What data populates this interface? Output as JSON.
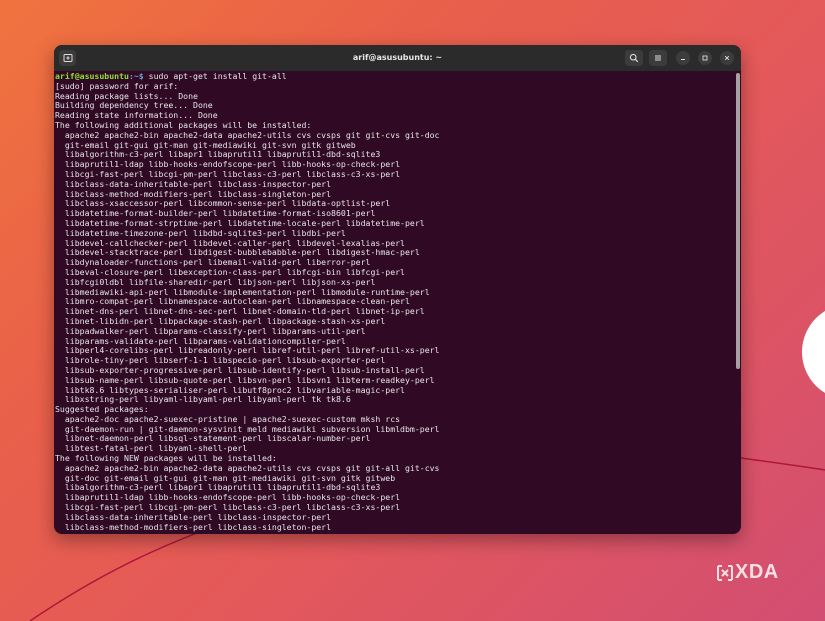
{
  "window": {
    "title": "arif@asusubuntu: ~"
  },
  "prompt": {
    "user_host": "arif@asusubuntu",
    "path_sep": ":~$",
    "command": " sudo apt-get install git-all"
  },
  "output_lines": [
    "[sudo] password for arif:",
    "Reading package lists... Done",
    "Building dependency tree... Done",
    "Reading state information... Done",
    "The following additional packages will be installed:",
    "  apache2 apache2-bin apache2-data apache2-utils cvs cvsps git git-cvs git-doc",
    "  git-email git-gui git-man git-mediawiki git-svn gitk gitweb",
    "  libalgorithm-c3-perl libapr1 libaprutil1 libaprutil1-dbd-sqlite3",
    "  libaprutil1-ldap libb-hooks-endofscope-perl libb-hooks-op-check-perl",
    "  libcgi-fast-perl libcgi-pm-perl libclass-c3-perl libclass-c3-xs-perl",
    "  libclass-data-inheritable-perl libclass-inspector-perl",
    "  libclass-method-modifiers-perl libclass-singleton-perl",
    "  libclass-xsaccessor-perl libcommon-sense-perl libdata-optlist-perl",
    "  libdatetime-format-builder-perl libdatetime-format-iso8601-perl",
    "  libdatetime-format-strptime-perl libdatetime-locale-perl libdatetime-perl",
    "  libdatetime-timezone-perl libdbd-sqlite3-perl libdbi-perl",
    "  libdevel-callchecker-perl libdevel-caller-perl libdevel-lexalias-perl",
    "  libdevel-stacktrace-perl libdigest-bubblebabble-perl libdigest-hmac-perl",
    "  libdynaloader-functions-perl libemail-valid-perl liberror-perl",
    "  libeval-closure-perl libexception-class-perl libfcgi-bin libfcgi-perl",
    "  libfcgi0ldbl libfile-sharedir-perl libjson-perl libjson-xs-perl",
    "  libmediawiki-api-perl libmodule-implementation-perl libmodule-runtime-perl",
    "  libmro-compat-perl libnamespace-autoclean-perl libnamespace-clean-perl",
    "  libnet-dns-perl libnet-dns-sec-perl libnet-domain-tld-perl libnet-ip-perl",
    "  libnet-libidn-perl libpackage-stash-perl libpackage-stash-xs-perl",
    "  libpadwalker-perl libparams-classify-perl libparams-util-perl",
    "  libparams-validate-perl libparams-validationcompiler-perl",
    "  libperl4-corelibs-perl libreadonly-perl libref-util-perl libref-util-xs-perl",
    "  librole-tiny-perl libserf-1-1 libspecio-perl libsub-exporter-perl",
    "  libsub-exporter-progressive-perl libsub-identify-perl libsub-install-perl",
    "  libsub-name-perl libsub-quote-perl libsvn-perl libsvn1 libterm-readkey-perl",
    "  libtk8.6 libtypes-serialiser-perl libutf8proc2 libvariable-magic-perl",
    "  libxstring-perl libyaml-libyaml-perl libyaml-perl tk tk8.6",
    "Suggested packages:",
    "  apache2-doc apache2-suexec-pristine | apache2-suexec-custom mksh rcs",
    "  git-daemon-run | git-daemon-sysvinit meld mediawiki subversion libmldbm-perl",
    "  libnet-daemon-perl libsql-statement-perl libscalar-number-perl",
    "  libtest-fatal-perl libyaml-shell-perl",
    "The following NEW packages will be installed:",
    "  apache2 apache2-bin apache2-data apache2-utils cvs cvsps git git-all git-cvs",
    "  git-doc git-email git-gui git-man git-mediawiki git-svn gitk gitweb",
    "  libalgorithm-c3-perl libapr1 libaprutil1 libaprutil1-dbd-sqlite3",
    "  libaprutil1-ldap libb-hooks-endofscope-perl libb-hooks-op-check-perl",
    "  libcgi-fast-perl libcgi-pm-perl libclass-c3-perl libclass-c3-xs-perl",
    "  libclass-data-inheritable-perl libclass-inspector-perl",
    "  libclass-method-modifiers-perl libclass-singleton-perl"
  ],
  "watermark": {
    "text": "XDA"
  },
  "colors": {
    "terminal_bg": "#300a24",
    "prompt_user": "#8ae234",
    "prompt_path": "#729fcf",
    "text": "#e6e6e6"
  },
  "icons": {
    "new_tab": "new-tab-icon",
    "search": "search-icon",
    "menu": "hamburger-menu-icon",
    "minimize": "minimize-icon",
    "maximize": "maximize-icon",
    "close": "close-icon"
  }
}
